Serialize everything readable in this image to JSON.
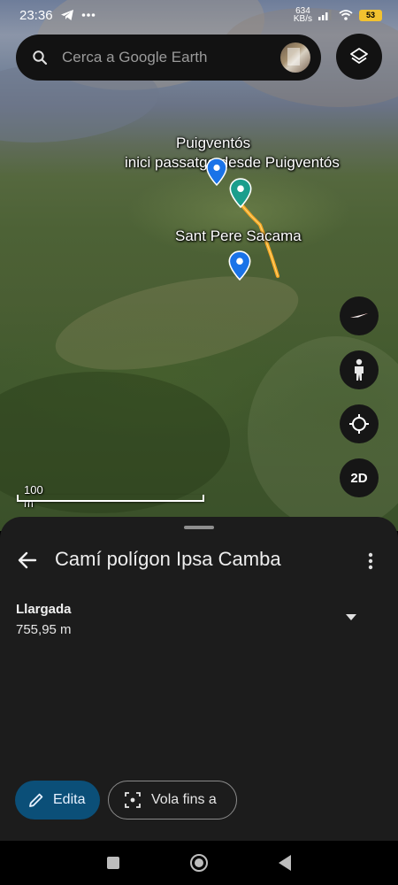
{
  "status_bar": {
    "time": "23:36",
    "notification_icons": [
      "telegram-icon",
      "more-dots-icon"
    ],
    "net_speed_value": "634",
    "net_speed_unit": "KB/s",
    "battery_level": "53",
    "system_icons": [
      "signal-icon",
      "wifi-icon",
      "battery-icon"
    ]
  },
  "search": {
    "placeholder": "Cerca a Google Earth",
    "value": ""
  },
  "map": {
    "labels": [
      {
        "text": "Puigventós"
      },
      {
        "text": "inici passatge desde Puigventós"
      },
      {
        "text": "Sant Pere Sacama"
      }
    ],
    "pins": [
      {
        "color": "#1a73e8"
      },
      {
        "color": "#1a9e8c"
      },
      {
        "color": "#1a73e8"
      }
    ],
    "track_color": "#f5a623",
    "scale_label": "100 m",
    "controls": {
      "compass_icon": "compass-icon",
      "pegman_icon": "pegman-icon",
      "location_icon": "my-location-icon",
      "view_mode_label": "2D"
    }
  },
  "sheet": {
    "title": "Camí polígon Ipsa Camba",
    "field_label": "Llargada",
    "field_value": "755,95 m",
    "edit_label": "Edita",
    "fly_label": "Vola fins a",
    "accent_color": "#0b4f78"
  },
  "nav_bar": {
    "icons": [
      "recents-icon",
      "home-icon",
      "back-icon"
    ]
  }
}
